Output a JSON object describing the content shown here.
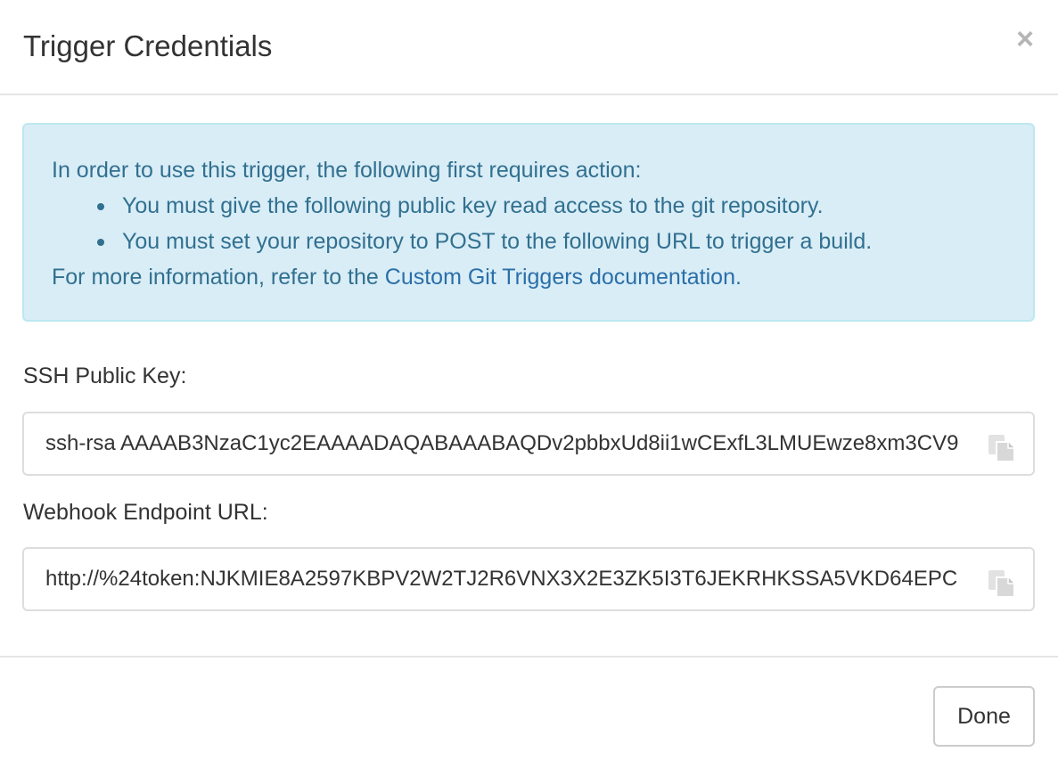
{
  "dialog": {
    "title": "Trigger Credentials",
    "close_label": "×"
  },
  "alert": {
    "intro": "In order to use this trigger, the following first requires action:",
    "bullets": [
      "You must give the following public key read access to the git repository.",
      "You must set your repository to POST to the following URL to trigger a build."
    ],
    "more_info_prefix": "For more information, refer to the ",
    "more_info_link": "Custom Git Triggers documentation",
    "more_info_suffix": ".",
    "background_color": "#d9edf7",
    "text_color": "#31708f"
  },
  "ssh_key": {
    "label": "SSH Public Key:",
    "value": "ssh-rsa AAAAB3NzaC1yc2EAAAADAQABAAABAQDv2pbbxUd8ii1wCExfL3LMUEwze8xm3CV9",
    "copy_icon": "clipboard-copy-icon"
  },
  "webhook": {
    "label": "Webhook Endpoint URL:",
    "value": "http://%24token:NJKMIE8A2597KBPV2W2TJ2R6VNX3X2E3ZK5I3T6JEKRHKSSA5VKD64EPC",
    "copy_icon": "clipboard-copy-icon"
  },
  "footer": {
    "done_label": "Done"
  }
}
